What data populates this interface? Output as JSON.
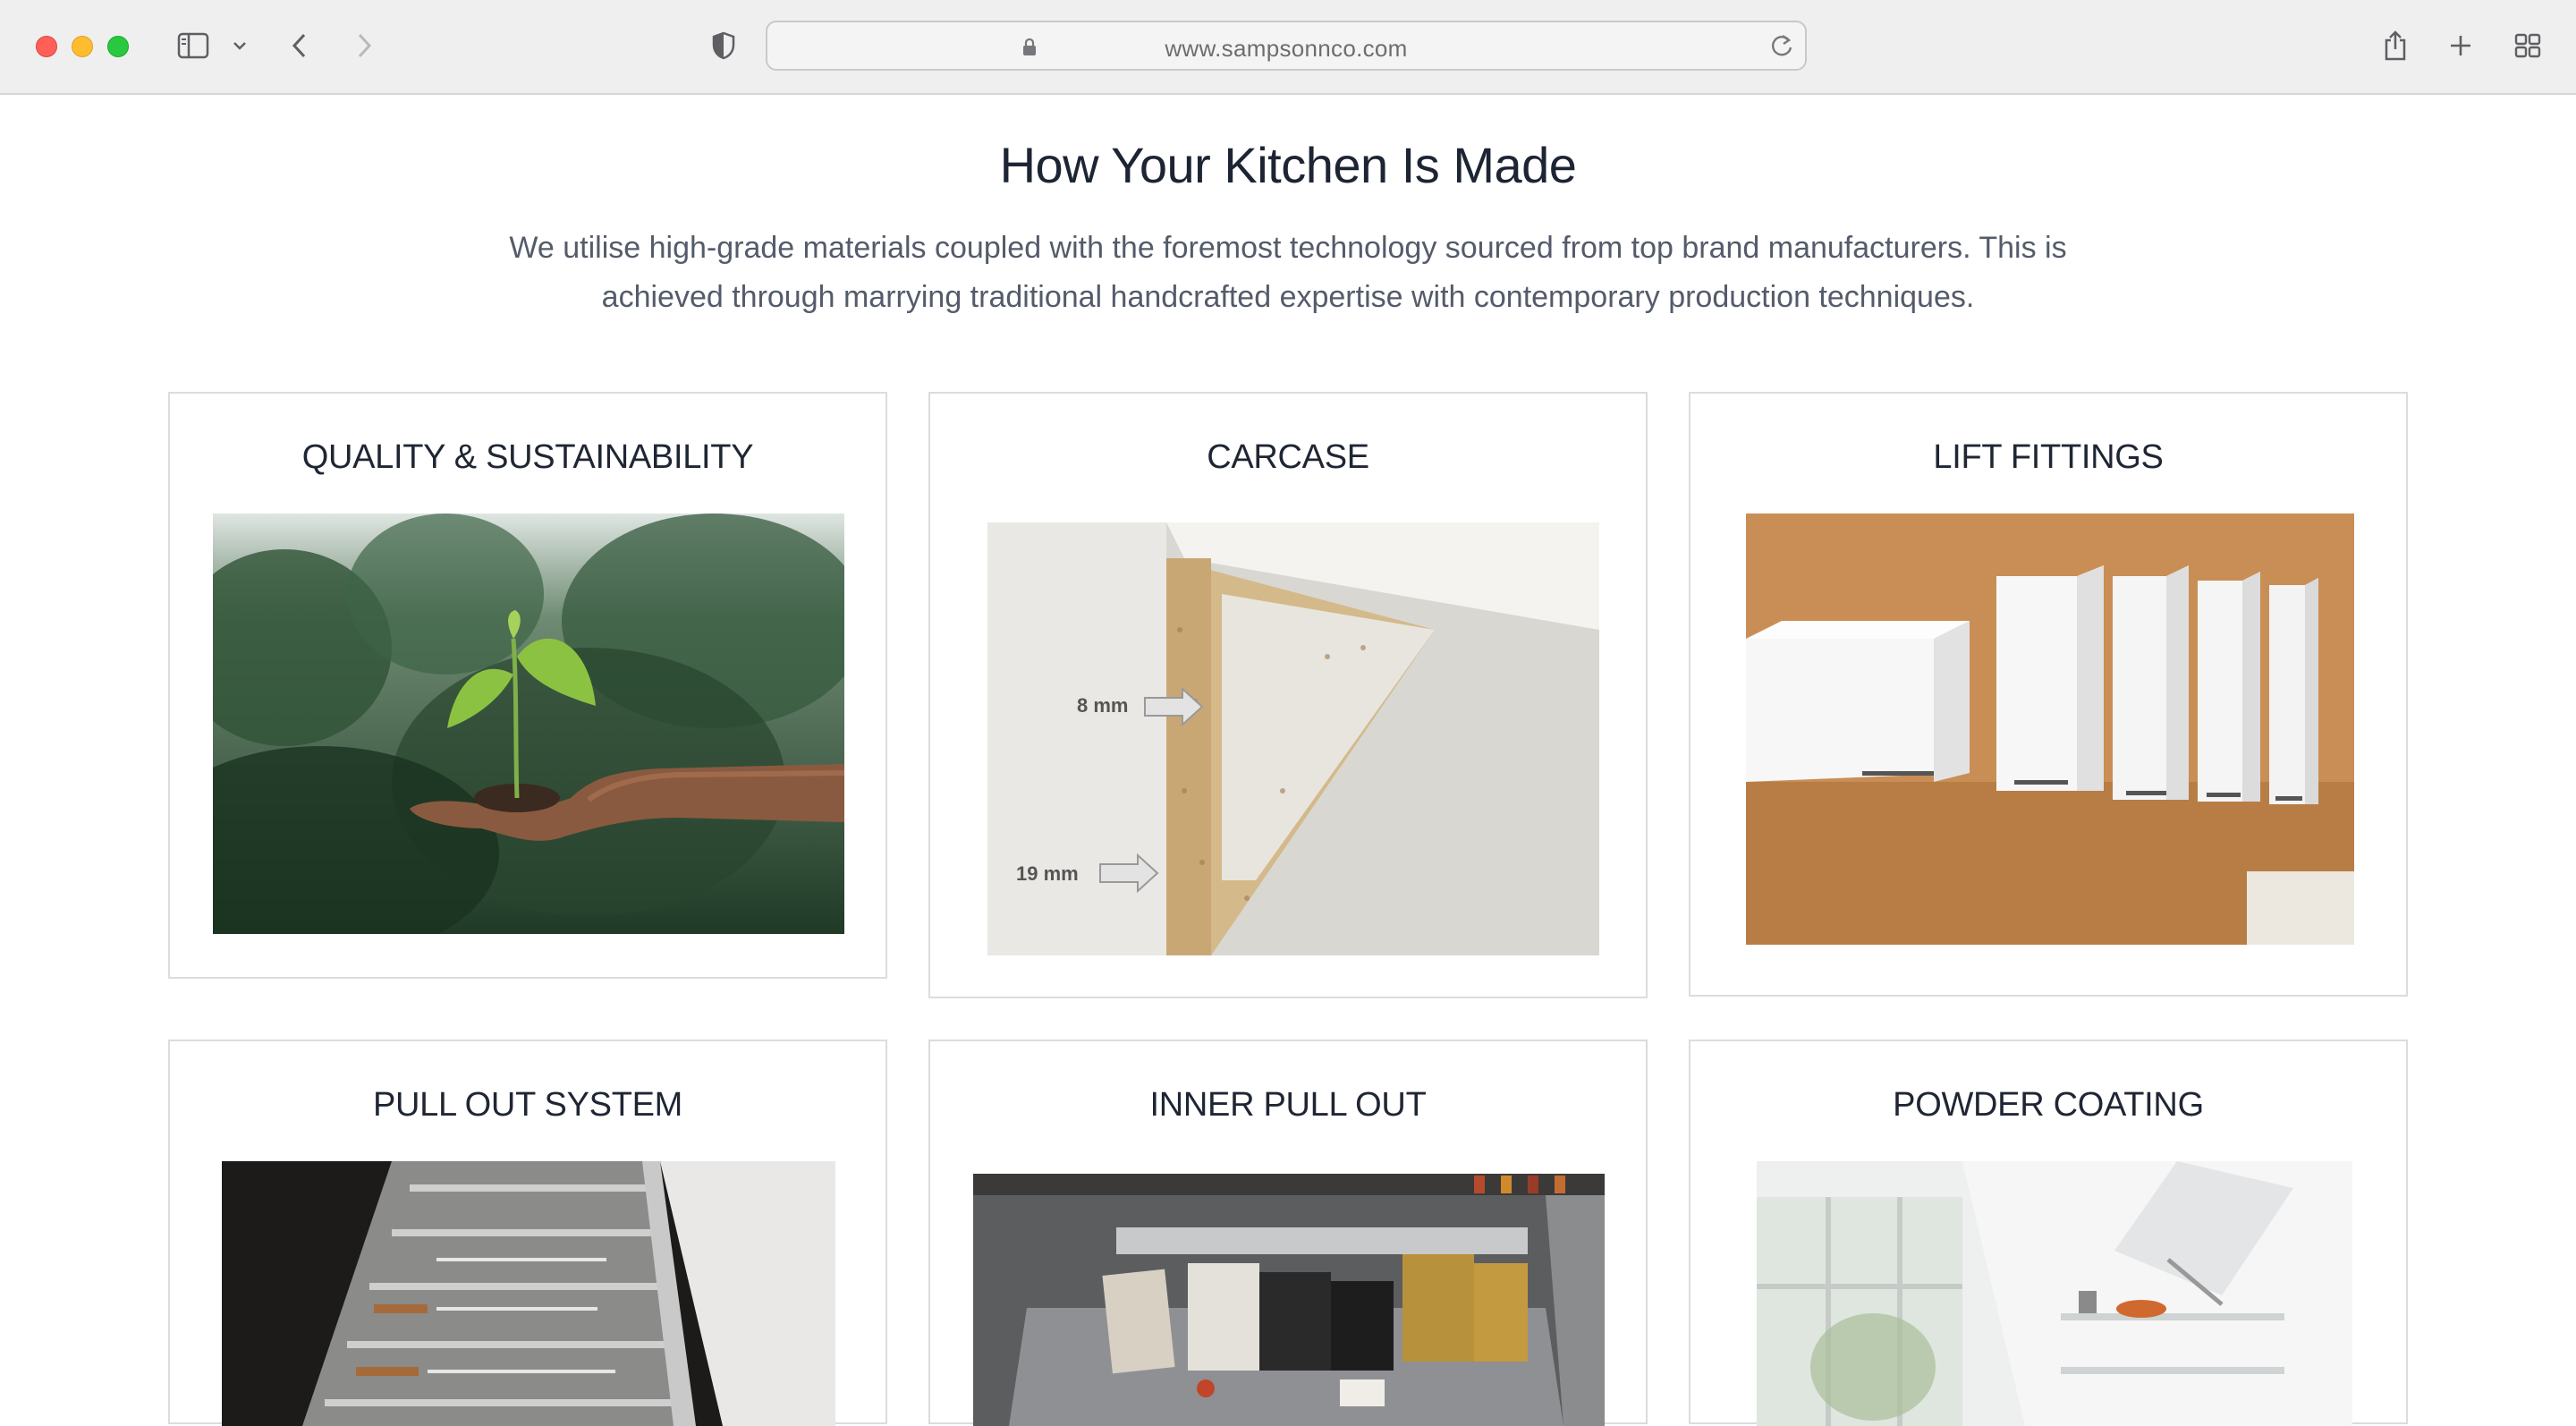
{
  "browser": {
    "url": "www.sampsonnco.com"
  },
  "page": {
    "title": "How Your Kitchen Is Made",
    "subtitle_line1": "We utilise high-grade materials coupled with the foremost technology sourced from top brand manufacturers. This is",
    "subtitle_line2": "achieved through marrying traditional handcrafted expertise with contemporary production techniques."
  },
  "cards": [
    {
      "title": "QUALITY & SUSTAINABILITY",
      "image": "seedling-in-hand-photo"
    },
    {
      "title": "CARCASE",
      "image": "chipboard-cross-section-photo",
      "label_top": "8 mm",
      "label_bottom": "19 mm"
    },
    {
      "title": "LIFT FITTINGS",
      "image": "wall-cabinets-photo"
    },
    {
      "title": "PULL OUT SYSTEM",
      "image": "cutlery-drawer-photo"
    },
    {
      "title": "INNER PULL OUT",
      "image": "pantry-pull-out-photo"
    },
    {
      "title": "POWDER COATING",
      "image": "lift-up-cabinet-photo"
    }
  ],
  "colors": {
    "title_text": "#1d2433",
    "body_text": "#545b6a",
    "card_border": "#dcdcdc",
    "chrome_bg": "#efeff0"
  }
}
